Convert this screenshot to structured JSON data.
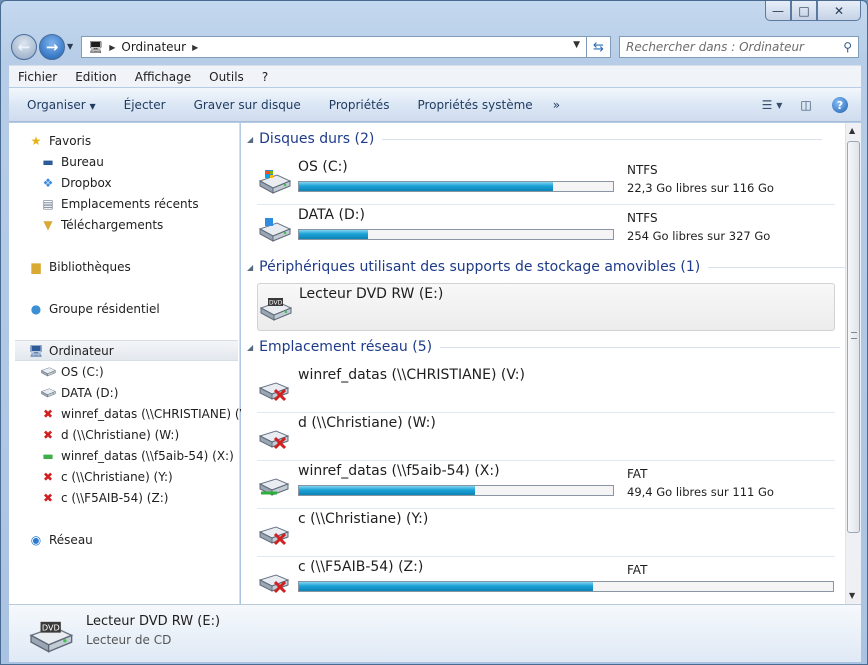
{
  "window": {
    "caption": {
      "minimize": "—",
      "maximize": "□",
      "close": "✕"
    }
  },
  "address": {
    "breadcrumb": "Ordinateur",
    "search_placeholder": "Rechercher dans : Ordinateur"
  },
  "menu": [
    "Fichier",
    "Edition",
    "Affichage",
    "Outils",
    "?"
  ],
  "commands": {
    "organize": "Organiser",
    "eject": "Éjecter",
    "burn": "Graver sur disque",
    "properties": "Propriétés",
    "system_properties": "Propriétés système",
    "more": "»"
  },
  "nav": {
    "favorites": "Favoris",
    "desktop": "Bureau",
    "dropbox": "Dropbox",
    "recent": "Emplacements récents",
    "downloads": "Téléchargements",
    "libraries": "Bibliothèques",
    "homegroup": "Groupe résidentiel",
    "computer": "Ordinateur",
    "drives": [
      "OS (C:)",
      "DATA (D:)",
      "winref_datas (\\\\CHRISTIANE) (V:)",
      "d (\\\\Christiane) (W:)",
      "winref_datas (\\\\f5aib-54) (X:)",
      "c (\\\\Christiane) (Y:)",
      "c (\\\\F5AIB-54) (Z:)"
    ],
    "network": "Réseau"
  },
  "groups": {
    "hdd": "Disques durs (2)",
    "removable": "Périphériques utilisant des supports de stockage amovibles (1)",
    "network": "Emplacement réseau (5)"
  },
  "drives": {
    "c": {
      "name": "OS (C:)",
      "fs": "NTFS",
      "free": "22,3 Go libres sur 116 Go",
      "used_fraction": 0.81
    },
    "d": {
      "name": "DATA (D:)",
      "fs": "NTFS",
      "free": "254 Go libres sur 327 Go",
      "used_fraction": 0.22
    },
    "e": {
      "name": "Lecteur DVD RW (E:)"
    },
    "v": {
      "name": "winref_datas (\\\\CHRISTIANE) (V:)"
    },
    "w": {
      "name": "d (\\\\Christiane) (W:)"
    },
    "x": {
      "name": "winref_datas (\\\\f5aib-54) (X:)",
      "fs": "FAT",
      "free": "49,4 Go libres sur 111 Go",
      "used_fraction": 0.56
    },
    "y": {
      "name": "c (\\\\Christiane) (Y:)"
    },
    "z": {
      "name": "c (\\\\F5AIB-54) (Z:)",
      "fs": "FAT",
      "used_fraction": 0.55
    }
  },
  "details": {
    "title": "Lecteur DVD RW (E:)",
    "subtitle": "Lecteur de CD"
  },
  "colors": {
    "accent": "#1e3b8a",
    "bar_fill": "#1aa2d6",
    "disconnected": "#d0201f"
  }
}
